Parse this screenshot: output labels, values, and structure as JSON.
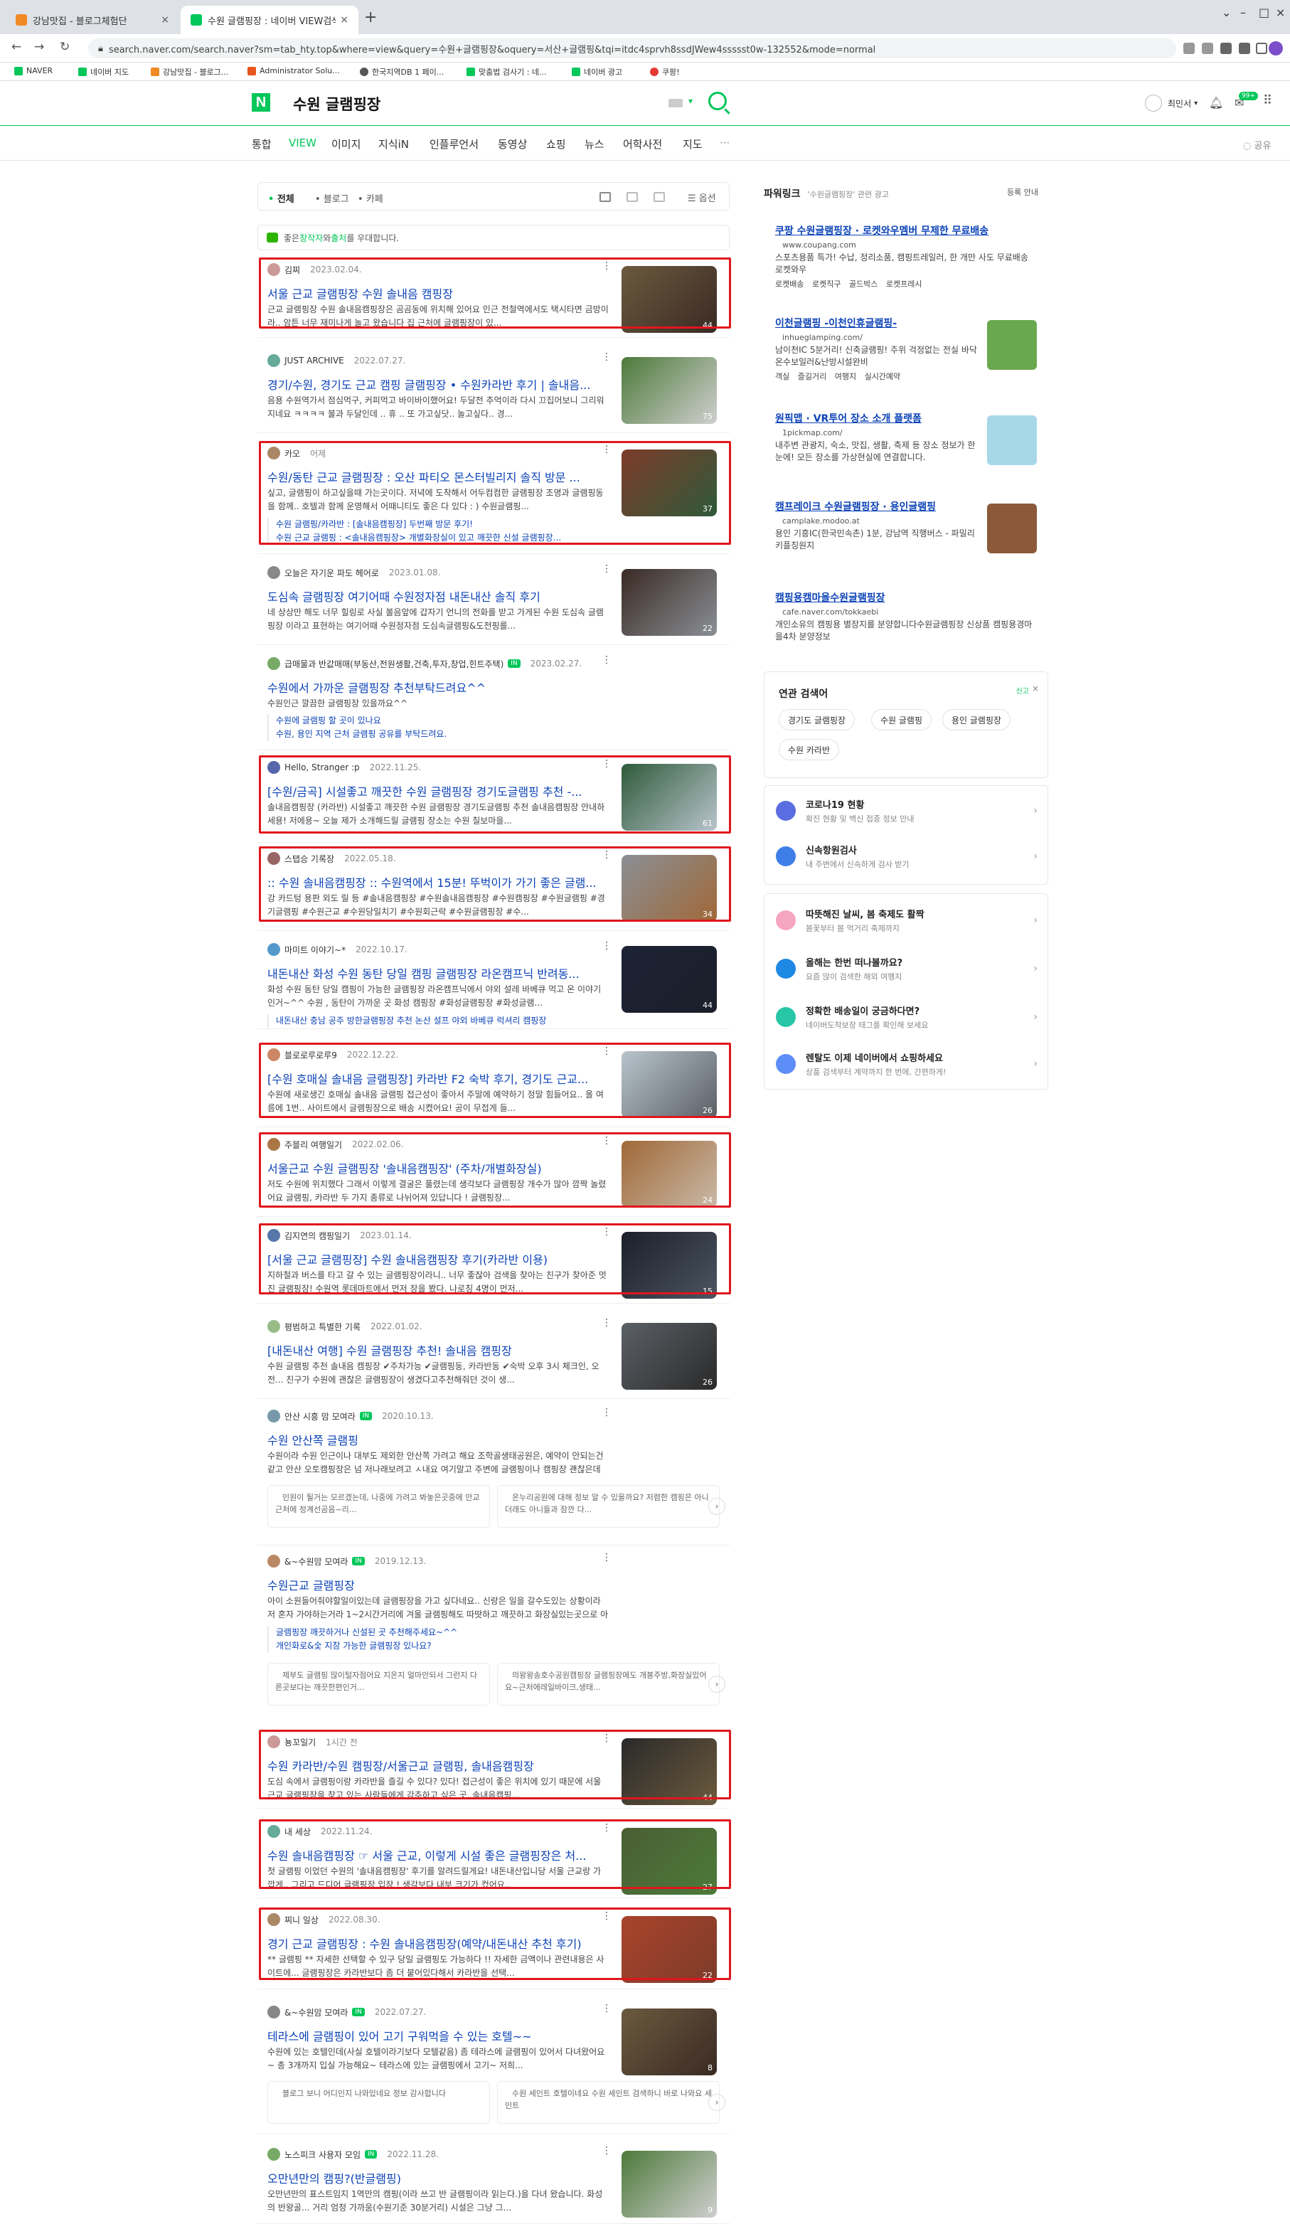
{
  "browser": {
    "tabs": [
      {
        "title": "강남맛집 - 블로그체험단",
        "active": false
      },
      {
        "title": "수원 글램핑장 : 네이버 VIEW검색",
        "active": true
      }
    ],
    "url": "search.naver.com/search.naver?sm=tab_hty.top&where=view&query=수원+글램핑장&oquery=서산+글램핑&tqi=itdc4sprvh8ssdJWew4ssssst0w-132552&mode=normal",
    "bookmarks": [
      "NAVER",
      "네이버 지도",
      "강남맛집 - 블로그...",
      "Administrator Solu...",
      "한국지역DB 1 페이...",
      "맞춤법 검사기 : 네...",
      "네이버 광고",
      "쿠팡!"
    ]
  },
  "header": {
    "query": "수원 글램핑장",
    "user": "최민서",
    "mail_badge": "99+"
  },
  "search_tabs": [
    "통합",
    "VIEW",
    "이미지",
    "지식iN",
    "인플루언서",
    "동영상",
    "쇼핑",
    "뉴스",
    "어학사전",
    "지도"
  ],
  "more_tabs": "···",
  "share_label": "공유",
  "filters": {
    "all": "전체",
    "blog": "블로그",
    "cafe": "카페",
    "options": "옵션"
  },
  "notice": {
    "pre": "좋은 ",
    "a": "창작자",
    "mid": "와 ",
    "b": "출처",
    "post": "를 우대합니다."
  },
  "posts": [
    {
      "author": "김찌",
      "date": "2023.02.04.",
      "title": "서울 근교 글램핑장 수원 솔내음 캠핑장",
      "snippet": "근교 글램핑장 수원 솔내음캠핑장은 곰곰동에 위치해 있어요 인근 전철역에서도 택시타면 금방이라.. 암튼 너무 재미나게 놀고 왔습니다 집 근처에 글램핑장이 있...",
      "count": "44",
      "boxed": true
    },
    {
      "author": "JUST ARCHIVE",
      "date": "2022.07.27.",
      "title": "경기/수원, 경기도 근교 캠핑 글램핑장 • 수원카라반 후기 | 솔내음...",
      "snippet": "음용 수원역가서 점심먹구, 커피먹고 바이바이했어요! 두달전 추억이라 다시 끄집어보니 그리워지네요 ㅋㅋㅋㅋ 불과 두달인데 .. 휴 .. 또 가고싶닷.. 놀고싶다.. 경...",
      "count": "75",
      "boxed": false
    },
    {
      "author": "카오",
      "date": "어제",
      "title": "수원/동탄 근교 글램핑장 : 오산 파티오 몬스터빌리지 솔직 방문 ...",
      "snippet": "싶고, 글램핑이 하고싶을때 가는곳이다. 저녁에 도착해서 어두컴컴한 글램핑장 조명과 글램핑동을 함께.. 호텔과 함께 운영해서 어때니티도 좋은 다 있다 : ) 수원글램핑...",
      "count": "37",
      "boxed": true,
      "sublinks": [
        "수원 글램핑/카라반 : [솔내음캠핑장] 두번째 방문 후기!",
        "수원 근교 글램핑 : <솔내음캠핑장> 개별화장실이 있고 깨끗한 신설 글램핑장..."
      ]
    },
    {
      "author": "오늘은 자기운 파도 헤어로",
      "date": "2023.01.08.",
      "title": "도심속 글램핑장 여기어때 수원정자점 내돈내산 솔직 후기",
      "snippet": "네 상상만 해도 너무 힐링로 사실 볼음앞에 갑자기 언니의 전화를 받고 가게된 수원 도심속 글램핑장 이라고 표현하는 여기어때 수원정자점 도심속글램핑&도전핑를...",
      "count": "22",
      "boxed": false
    },
    {
      "author": "급매물과 반값매매(부동산,전원생활,건축,투자,창업,힌트주택)",
      "date": "2023.02.27.",
      "badge": "IN",
      "title": "수원에서 가까운 글램핑장 추천부탁드려요^^",
      "snippet": "수원인근 깔끔한 글램핑장 있을까요^^",
      "count": "",
      "boxed": false,
      "sublinks": [
        "수원에 글램핑 할 곳이 있나요",
        "수원, 용인 지역 근처 글램핑 공유를 부탁드려요."
      ]
    },
    {
      "author": "Hello, Stranger :p",
      "date": "2022.11.25.",
      "title": "[수원/금곡] 시설좋고 깨끗한 수원 글램핑장 경기도글램핑 추천 -...",
      "snippet": "솔내음캠핑장 (카라반) 시설좋고 깨끗한 수원 글램핑장 경기도글램핑 추천 솔내음캠핑장 안내하세용! 저에용~ 오늘 제가 소개해드릴 글램핑 장소는 수원 칠보마을...",
      "count": "61",
      "boxed": true
    },
    {
      "author": "스탭승 기록장",
      "date": "2022.05.18.",
      "title": ":: 수원 솔내음캠핑장 :: 수원역에서 15분! 뚜벅이가 가기 좋은 글램...",
      "snippet": "강 카드텅 용판 외도 릴 등 #솔내음캠핑장 #수원솔내음캠핑장 #수원캠핑장 #수원글램핑 #경기글램핑 #수원근교 #수원당일치기 #수원회근락 #수원글램핑장 #수...",
      "count": "34",
      "boxed": true
    },
    {
      "author": "마미트 이야기~*",
      "date": "2022.10.17.",
      "title": "내돈내산 화성 수원 동탄 당일 캠핑 글램핑장 라온캠프닉 반려동...",
      "snippet": "화성 수원 동탄 당일 캠핑이 가능한 글램핑장 라온캠프닉에서 야외 설레 바베큐 먹고 온 이야기 인거~^^ 수원 , 동탄이 가까운 곳 화성 캠핑장 #화성글램핑장 #화성글램...",
      "count": "44",
      "boxed": false,
      "sublinks": [
        "내돈내산 충남 공주 방한글램핑장 추천 논산 설프 야외 바베큐 럭셔리 캠핑장"
      ]
    },
    {
      "author": "블로로루로루9",
      "date": "2022.12.22.",
      "title": "[수원 호매실 솔내음 글램핑장] 카라반 F2 숙박 후기, 경기도 근교...",
      "snippet": "수원에 새로생긴 호매실 솔내음 글램핑 접근성이 좋아서 주말에 예약하기 정말 힘들어요.. 올 여름에 1번.. 사이트에서 글램핑장으로 배송 시켰어요! 공이 무접게 들...",
      "count": "26",
      "boxed": true
    },
    {
      "author": "주블리 여행일기",
      "date": "2022.02.06.",
      "title": "서울근교 수원 글램핑장 '솔내음캠핑장' (주차/개별화장실)",
      "snippet": "저도 수원에 위치했다 그래서 이렇게 결굴은 풀렸는데 생각보다 글램핑장 개수가 많아 깜짝 놀렸어요 글램핑, 카라반 두 가지 종류로 나뉘어져 있답니다 ! 글램핑장...",
      "count": "24",
      "boxed": true
    },
    {
      "author": "김지연의 캠핑일기",
      "date": "2023.01.14.",
      "title": "[서울 근교 글램핑장] 수원 솔내음캠핑장 후기(카라반 이용)",
      "snippet": "지하철과 버스를 타고 갈 수 있는 글램핑장이라니.. 너무 좋잖아 검색을 찾아는 친구가 찾아준 멋진 글램핑장! 수원역 롯데마트에서 먼저 장을 봤다. 나로칭 4명이 먼저...",
      "count": "15",
      "boxed": true
    },
    {
      "author": "평범하고 특별한 기록",
      "date": "2022.01.02.",
      "title": "[내돈내산 여행] 수원 글램핑장 추천! 솔내음 캠핑장",
      "snippet": "수원 글램핑 추천 솔내음 캠핑장 ✔주차가능 ✔글램핑동, 카라반동 ✔숙박 오후 3시 체크인, 오전... 친구가 수원에 괜찮은 글램핑장이 생겼다고추천해줘던 것이 생...",
      "count": "26",
      "boxed": false
    }
  ],
  "cafe_posts": [
    {
      "author": "안산 시흥 맘 모여라",
      "badge": "IN",
      "date": "2020.10.13.",
      "title": "수원 안산쪽 글램핑",
      "snippet": "수원이라 수원 인근이나 대부도 제외한 안산쪽 가려고 해요 조학골생태공원은, 예약이 안되는건 같고 안산 오토캠핑장은 넘 저나래보려고 ㅅ내요 여기말고 주변에 글램핑이나 캠핑장 괜찮은데 있을까요?인원은 10명...",
      "cards": [
        "인원이 될거는 모르겠는데, 나중에 가려고 봐놓은곳중에 안교근처에 정계선곰음~리...",
        "온누리공원에 대해 정보 알 수 있을까요? 저렴한 캠핑은 아니더래도 아니들과 잠깐 다..."
      ]
    },
    {
      "author": "&~수원맘 모여라",
      "badge": "IN",
      "date": "2019.12.13.",
      "title": "수원근교 글램핑장",
      "snippet": "아이 소원들어줘야할일이있는데 글램핑장을 가고 싶다네요.. 신랑은 일을 갈수도있는 상황이라 저 혼자 가야하는거라 1~2시간거리에 겨울 글램핑해도 따땃하고 깨끗하고 화장실있는곳으로 아이들 놀려가...",
      "cards": [
        "제부도 글램핑 많이털자점어요 지온지 얼마안되서 그런지 다른곳보다는 깨끗한편인거...",
        "의왕왕송호수공원캠핑장 글램핑장에도 개봉주방,화장실있어요~근처에레일바이크,생태..."
      ],
      "sublinks": [
        "글램핑장 깨끗하거나 신설된 곳 추천해주세요~^^",
        "개인화로&숯 지참 가능한 글램핑장 있나요?"
      ]
    }
  ],
  "posts2": [
    {
      "author": "뇽꼬일기",
      "date": "1시간 전",
      "title": "수원 카라반/수원 캠핑장/서울근교 글램핑, 솔내음캠핑장",
      "snippet": "도심 속에서 글램핑이랑 카라반을 즐길 수 있다? 있다! 접근성이 좋은 위치에 있기 때문에 서울근교 글램핑장을 찾고 있는 사람들에게 강추하고 싶은 곳, 솔내음캠핑...",
      "count": "44",
      "boxed": true
    },
    {
      "author": "내 세상",
      "date": "2022.11.24.",
      "title": "수원 솔내음캠핑장 ☞ 서울 근교, 이렇게 시설 좋은 글램핑장은 처...",
      "snippet": "첫 글램핑 이었던 수원의 '솔내음캠핑장' 후기를 알려드릴게요! 내돈내산입니당 서울 근교랑 가깝게.. 그리고 드디어 글램핑장 입장 ! 생각보다 내부 크기가 컸어요..",
      "count": "27",
      "boxed": true
    },
    {
      "author": "찌니 일상",
      "date": "2022.08.30.",
      "title": "경기 근교 글램핑장 : 수원 솔내음캠핑장(예약/내돈내산 추천 후기)",
      "snippet": "** 글램핑 ** 자세한 선택할 수 있구 당일 글램핑도 가능하다 !! 자세한 금액이나 관련내용은 사이트에... 글램핑장은 카라반보다 좀 더 붙어있다해서 카라반을 선택...",
      "count": "22",
      "boxed": true
    },
    {
      "author": "&~수원맘 모여라",
      "badge": "IN",
      "date": "2022.07.27.",
      "title": "테라스에 글램핑이 있어 고기 구워먹을 수 있는 호텔~~",
      "snippet": "수원에 있는 호텔인데(사실 호텔이라기보다 모텔같음) 좀 테라스에 글램핑이 있어서 다녀왔어요~ 총 3개까지 입실 가능해요~ 테라스에 있는 글램핑에서 고기~ 저희...",
      "count": "8",
      "boxed": false,
      "cards": [
        "블로그 보니 어디인지 나와있네요 정보 감사합니다",
        "수원 세인트 호텔이네요 수원 세인트 검색하니 바로 나와요 세인트"
      ]
    },
    {
      "author": "노스피크 사용자 모임",
      "badge": "IN",
      "date": "2022.11.28.",
      "title": "오만년만의 캠핑?(반글램핑)",
      "snippet": "오만년만의 표스트임지 1역만의 캠핑(이라 쓰고 반 글램핑이라 읽는다.)을 다녀 왔습니다. 화성의 반왕골... 거리 엄청 가까움(수원기준 30분거리) 시설은 그냥 그...",
      "count": "9",
      "boxed": false
    }
  ],
  "powerlink": {
    "title": "파워링크",
    "subtitle": "'수원글램핑장' 관련 광고",
    "reg": "등록 안내",
    "ads": [
      {
        "title": "쿠팡 수원글램핑장 · 로켓와우멤버 무제한 무료배송",
        "url": "www.coupang.com",
        "desc": "스포츠용품 특가! 수납, 정리소품, 캠핑트레일러, 한 개만 사도 무료배송 로켓와우",
        "links": "로켓배송  로켓직구  골드박스  로켓프레시"
      },
      {
        "title": "이천글램핑 -이천인휴글램핑-",
        "url": "inhueglamping.com/",
        "desc": "남이천IC 5분거리! 신축글램핑! 주위 걱정없는 전실 바닥온수보일러&난방시설완비",
        "links": "객실  즐길거리  여행지  실시간예약"
      },
      {
        "title": "원픽맵 · VR투어 장소 소개 플랫폼",
        "url": "1pickmap.com/",
        "desc": "내주변 관광지, 숙소, 맛집, 생활, 축제 등 장소 정보가 한눈에! 모든 장소를 가상현실에 연결합니다.",
        "links": ""
      },
      {
        "title": "캠프레이크 수원글램핑장 · 용인글램핑",
        "url": "camplake.modoo.at",
        "desc": "용인 기흥IC(한국민속촌) 1분, 강남역 직행버스 - 파밀리 키플칭원지",
        "links": ""
      },
      {
        "title": "캠핑용캠마을수원글램핑장",
        "url": "cafe.naver.com/tokkaebi",
        "desc": "개인소유의 캠핑용 별장지를 분양합니다수원글램핑장 신상품 캠핑용경마을4차 분양정보",
        "links": ""
      }
    ]
  },
  "related": {
    "title": "연관 검색어",
    "chips": [
      "경기도 글램핑장",
      "수원 글램핑",
      "용인 글램핑장",
      "수원 카라반"
    ]
  },
  "services1": [
    {
      "title": "코로나19 현황",
      "desc": "확진 현황 및 백신 접종 정보 안내"
    },
    {
      "title": "신속항원검사",
      "desc": "내 주변에서 신속하게 검사 받기"
    }
  ],
  "services2": [
    {
      "title": "따뜻해진 날씨, 봄 축제도 활짝",
      "desc": "봄꽃부터 봄 먹거리 축제까지"
    },
    {
      "title": "올해는 한번 떠나볼까요?",
      "desc": "요즘 많이 검색한 해외 여행지"
    },
    {
      "title": "정확한 배송일이 궁금하다면?",
      "desc": "네이버도착보장 태그를 확인해 보세요"
    },
    {
      "title": "렌탈도 이제 네이버에서 쇼핑하세요",
      "desc": "상품 검색부터 계약까지 한 번에, 간편하게!"
    }
  ]
}
